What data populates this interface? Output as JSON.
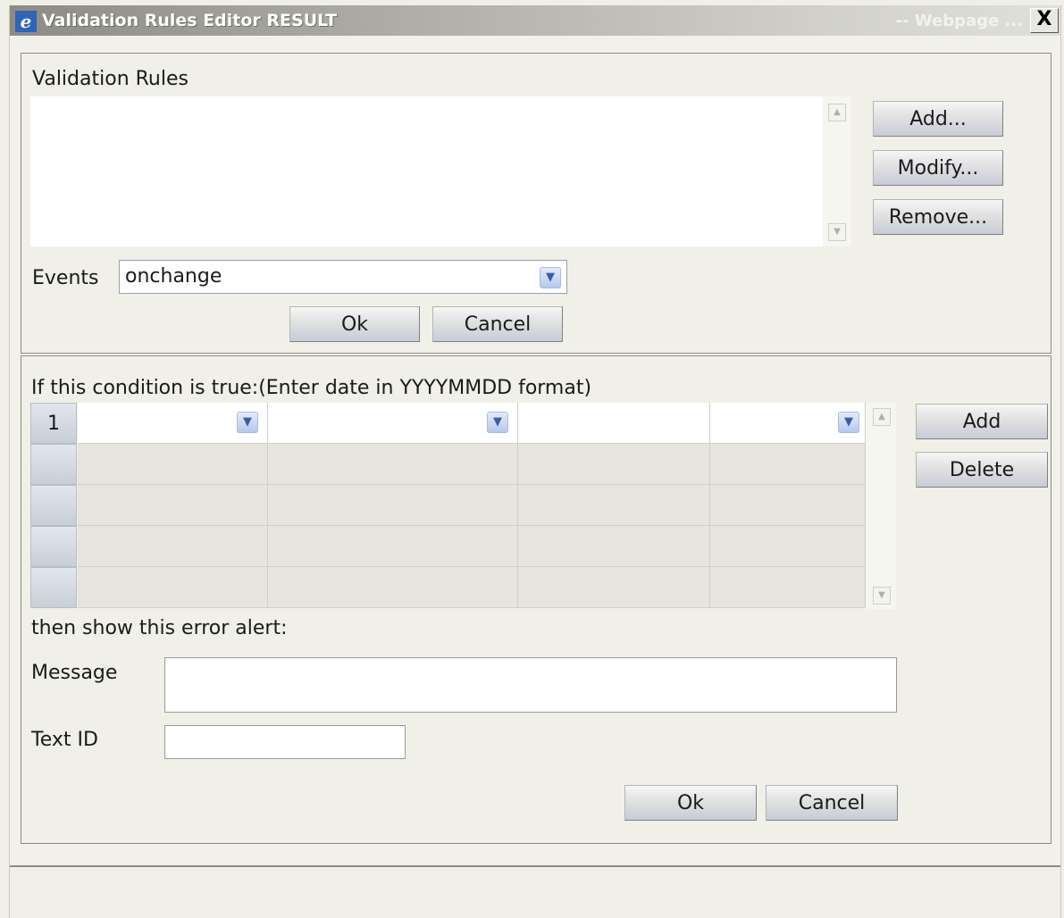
{
  "window": {
    "title": "Validation Rules Editor RESULT",
    "title_suffix": "-- Webpage ...",
    "close_label": "X",
    "app_icon": "ie-icon"
  },
  "rules_section": {
    "label": "Validation Rules",
    "buttons": {
      "add": "Add...",
      "modify": "Modify...",
      "remove": "Remove..."
    },
    "events_label": "Events",
    "events_value": "onchange",
    "ok": "Ok",
    "cancel": "Cancel"
  },
  "condition_section": {
    "label": "If this condition is true:(Enter date in YYYYMMDD format)",
    "rows": [
      {
        "number": "1",
        "cells": [
          "",
          "",
          "",
          ""
        ]
      },
      {
        "number": "",
        "cells": [
          "",
          "",
          "",
          ""
        ]
      },
      {
        "number": "",
        "cells": [
          "",
          "",
          "",
          ""
        ]
      },
      {
        "number": "",
        "cells": [
          "",
          "",
          "",
          ""
        ]
      },
      {
        "number": "",
        "cells": [
          "",
          "",
          "",
          ""
        ]
      }
    ],
    "add": "Add",
    "delete": "Delete",
    "alert_label": "then show this error alert:",
    "message_label": "Message",
    "message_value": "",
    "text_id_label": "Text ID",
    "text_id_value": "",
    "ok": "Ok",
    "cancel": "Cancel"
  },
  "colors": {
    "background": "#f0f0e8",
    "dropdown_accent": "#b5c8ec"
  }
}
